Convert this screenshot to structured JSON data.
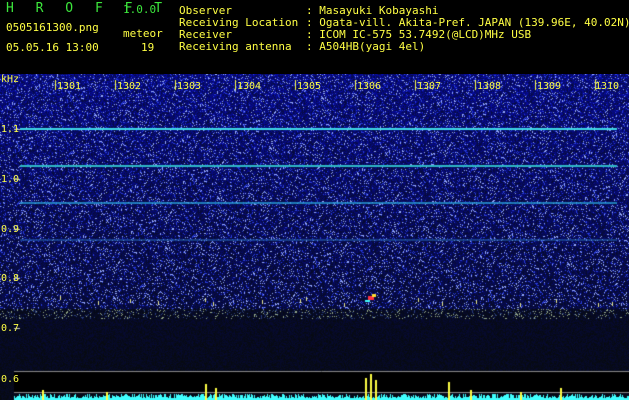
{
  "app": {
    "title": "H R O F F T",
    "version": "1.0.0"
  },
  "file": "0505161300.png",
  "datetime": "05.05.16 13:00",
  "meteor": {
    "label": "meteor",
    "count": "19"
  },
  "info": [
    {
      "label": "Observer",
      "value": ": Masayuki Kobayashi"
    },
    {
      "label": "Receiving Location",
      "value": ": Ogata-vill. Akita-Pref. JAPAN (139.96E, 40.02N)"
    },
    {
      "label": "Receiver",
      "value": ": ICOM IC-575 53.7492(@LCD)MHz USB"
    },
    {
      "label": "Receiving antenna",
      "value": ": A504HB(yagi 4el)"
    }
  ],
  "axis": {
    "unit": "kHz",
    "ticks": [
      "1.1",
      "1.0",
      "0.9",
      "0.8",
      "0.7",
      "0.6"
    ],
    "minutes": [
      "1301",
      "1302",
      "1303",
      "1304",
      "1305",
      "1306",
      "1307",
      "1308",
      "1309",
      "1310"
    ]
  },
  "colors": {
    "background": "#000000",
    "label_green": "#3ce63c",
    "label_yellow": "#ffff44",
    "spectrum_blue": "#1428c8",
    "trace_cyan": "#40ffff"
  }
}
